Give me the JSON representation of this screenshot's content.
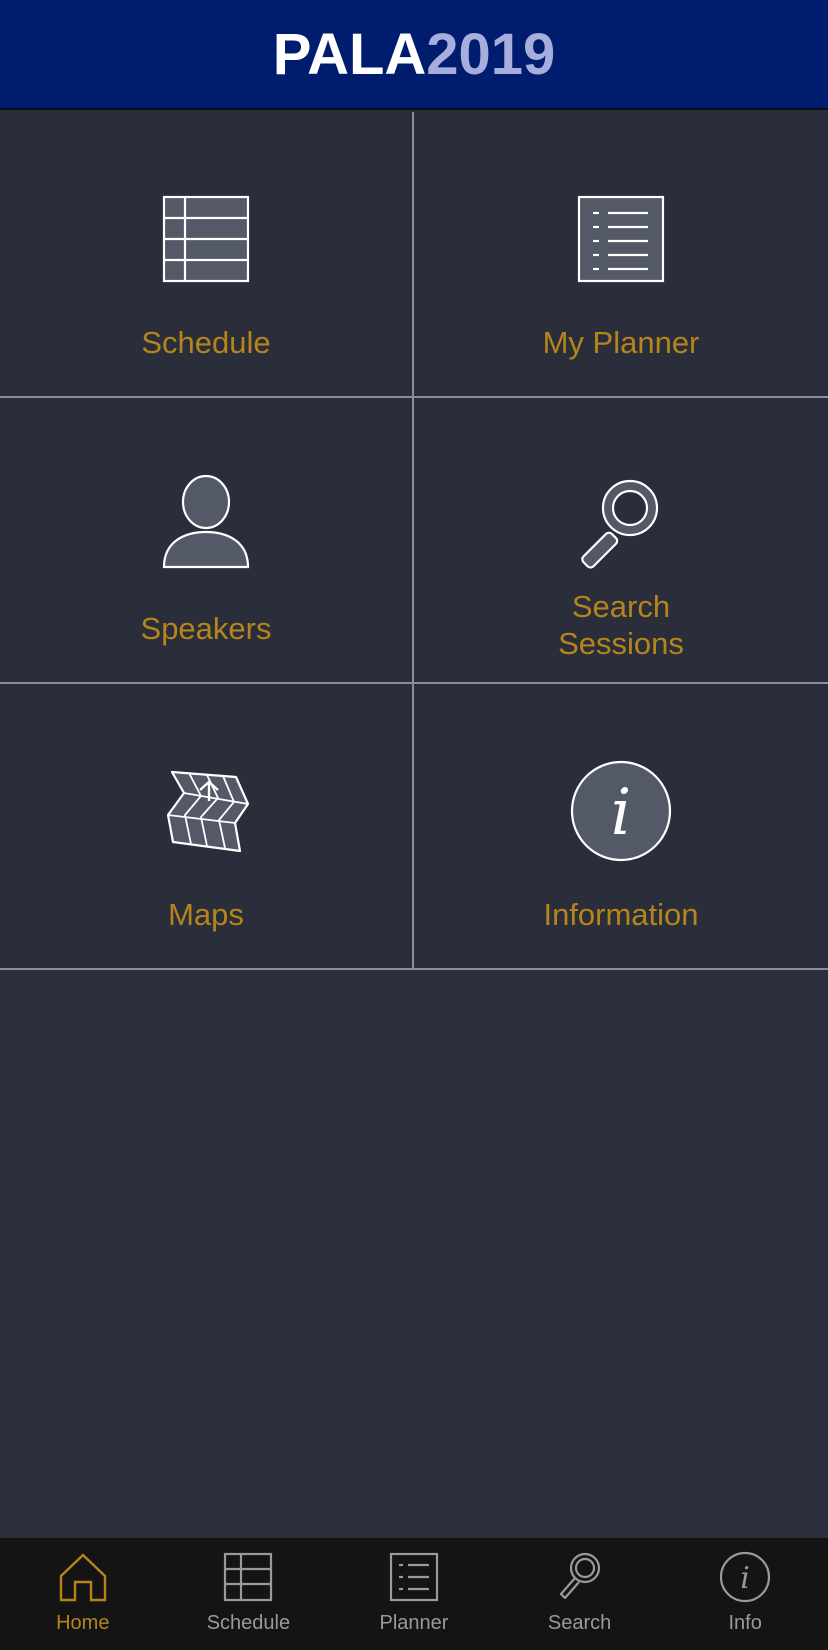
{
  "header": {
    "title_part1": "PALA",
    "title_part2": "2019"
  },
  "colors": {
    "header_bg": "#001c6e",
    "accent": "#b5841b",
    "tile_bg": "#2a2e3a",
    "tab_inactive": "#9a9a9a"
  },
  "tiles": [
    {
      "label": "Schedule",
      "icon": "table-icon"
    },
    {
      "label": "My Planner",
      "icon": "list-icon"
    },
    {
      "label": "Speakers",
      "icon": "person-icon"
    },
    {
      "label_line1": "Search",
      "label_line2": "Sessions",
      "icon": "search-icon"
    },
    {
      "label": "Maps",
      "icon": "map-icon"
    },
    {
      "label": "Information",
      "icon": "info-icon"
    }
  ],
  "tabs": [
    {
      "label": "Home",
      "icon": "home-icon",
      "active": true
    },
    {
      "label": "Schedule",
      "icon": "table-icon",
      "active": false
    },
    {
      "label": "Planner",
      "icon": "list-icon",
      "active": false
    },
    {
      "label": "Search",
      "icon": "search-icon",
      "active": false
    },
    {
      "label": "Info",
      "icon": "info-icon",
      "active": false
    }
  ]
}
